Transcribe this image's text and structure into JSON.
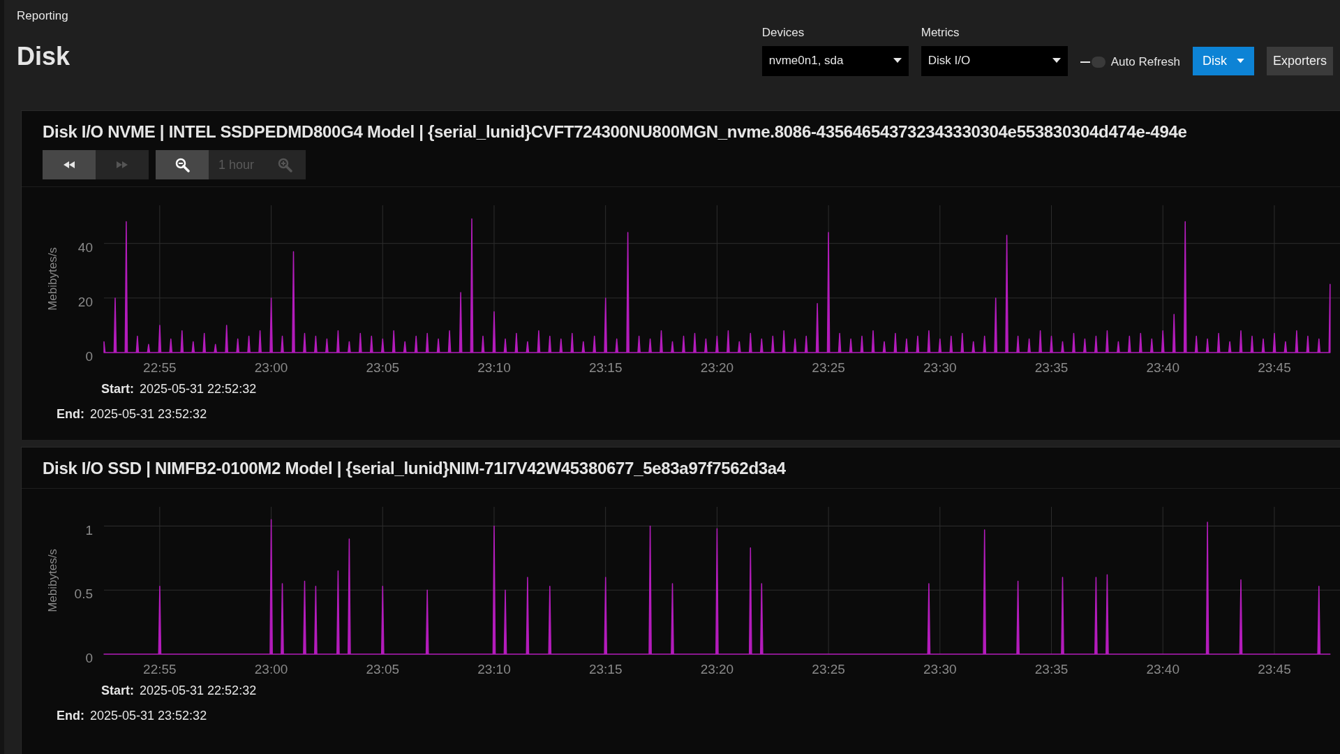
{
  "breadcrumb": "Reporting",
  "page_title": "Disk",
  "filters": [
    {
      "label": "Devices",
      "value": "nvme0n1, sda"
    },
    {
      "label": "Metrics",
      "value": "Disk I/O"
    }
  ],
  "auto_refresh": {
    "label": "Auto Refresh",
    "on": false
  },
  "buttons": [
    {
      "kind": "primary",
      "label": "Disk",
      "caret": true
    },
    {
      "kind": "secondary",
      "label": "Exporters",
      "caret": false
    }
  ],
  "charts": [
    {
      "title": "Disk I/O NVME | INTEL SSDPEDMD800G4 Model | {serial_lunid}CVFT724300NU800MGN_nvme.8086-435646543732343330304e553830304d474e-494e",
      "toolbar": {
        "nav": [
          {
            "kind": "rewind",
            "disabled": false
          },
          {
            "kind": "forward",
            "disabled": true
          }
        ],
        "zoom_out": {
          "disabled": false
        },
        "range": "1 hour",
        "zoom_in": {
          "disabled": true
        }
      },
      "chart_data": {
        "type": "area",
        "ylabel": "Mebibytes/s",
        "grid": true,
        "ylim": [
          0,
          54
        ],
        "yticks": [
          0,
          20,
          40
        ],
        "categories": [
          null,
          null,
          null,
          null,
          null,
          "22:55",
          null,
          null,
          null,
          null,
          null,
          null,
          null,
          null,
          null,
          "23:00",
          null,
          null,
          null,
          null,
          null,
          null,
          null,
          null,
          null,
          "23:05",
          null,
          null,
          null,
          null,
          null,
          null,
          null,
          null,
          null,
          "23:10",
          null,
          null,
          null,
          null,
          null,
          null,
          null,
          null,
          null,
          "23:15",
          null,
          null,
          null,
          null,
          null,
          null,
          null,
          null,
          null,
          "23:20",
          null,
          null,
          null,
          null,
          null,
          null,
          null,
          null,
          null,
          "23:25",
          null,
          null,
          null,
          null,
          null,
          null,
          null,
          null,
          null,
          "23:30",
          null,
          null,
          null,
          null,
          null,
          null,
          null,
          null,
          null,
          "23:35",
          null,
          null,
          null,
          null,
          null,
          null,
          null,
          null,
          null,
          "23:40",
          null,
          null,
          null,
          null,
          null,
          null,
          null,
          null,
          null,
          "23:45",
          null,
          null,
          null,
          null,
          null
        ],
        "series": [
          {
            "color": "#b41cbc",
            "values": [
              4,
              20,
              48,
              6,
              3,
              10,
              5,
              8,
              4,
              7,
              3,
              10,
              5,
              6,
              8,
              20,
              6,
              37,
              7,
              6,
              5,
              8,
              4,
              7,
              6,
              5,
              8,
              4,
              6,
              7,
              5,
              8,
              22,
              49,
              6,
              15,
              5,
              7,
              4,
              8,
              6,
              5,
              7,
              4,
              6,
              20,
              5,
              44,
              6,
              5,
              8,
              4,
              6,
              7,
              5,
              6,
              8,
              4,
              7,
              5,
              6,
              8,
              5,
              6,
              18,
              44,
              7,
              5,
              6,
              8,
              4,
              7,
              5,
              6,
              8,
              5,
              6,
              7,
              4,
              6,
              20,
              43,
              6,
              5,
              8,
              6,
              4,
              7,
              5,
              6,
              8,
              4,
              6,
              7,
              5,
              8,
              14,
              48,
              6,
              5,
              7,
              4,
              8,
              6,
              5,
              7,
              4,
              8,
              6,
              5,
              25
            ]
          }
        ]
      },
      "start_label": "Start:",
      "start": "2025-05-31 22:52:32",
      "end_label": "End:",
      "end": "2025-05-31 23:52:32"
    },
    {
      "title": "Disk I/O SSD | NIMFB2-0100M2 Model | {serial_lunid}NIM-71I7V42W45380677_5e83a97f7562d3a4",
      "chart_data": {
        "type": "area",
        "ylabel": "Mebibytes/s",
        "grid": true,
        "ylim": [
          0,
          1.15
        ],
        "yticks": [
          0,
          0.5,
          1
        ],
        "categories": [
          null,
          null,
          null,
          null,
          null,
          "22:55",
          null,
          null,
          null,
          null,
          null,
          null,
          null,
          null,
          null,
          "23:00",
          null,
          null,
          null,
          null,
          null,
          null,
          null,
          null,
          null,
          "23:05",
          null,
          null,
          null,
          null,
          null,
          null,
          null,
          null,
          null,
          "23:10",
          null,
          null,
          null,
          null,
          null,
          null,
          null,
          null,
          null,
          "23:15",
          null,
          null,
          null,
          null,
          null,
          null,
          null,
          null,
          null,
          "23:20",
          null,
          null,
          null,
          null,
          null,
          null,
          null,
          null,
          null,
          "23:25",
          null,
          null,
          null,
          null,
          null,
          null,
          null,
          null,
          null,
          "23:30",
          null,
          null,
          null,
          null,
          null,
          null,
          null,
          null,
          null,
          "23:35",
          null,
          null,
          null,
          null,
          null,
          null,
          null,
          null,
          null,
          "23:40",
          null,
          null,
          null,
          null,
          null,
          null,
          null,
          null,
          null,
          "23:45",
          null,
          null,
          null,
          null,
          null
        ],
        "series": [
          {
            "color": "#b41cbc",
            "values": [
              0,
              0,
              0,
              0,
              0,
              0.53,
              0,
              0,
              0,
              0,
              0,
              0,
              0,
              0,
              0,
              1.05,
              0.55,
              0,
              0.57,
              0.53,
              0,
              0.65,
              0.9,
              0,
              0,
              0.53,
              0,
              0,
              0,
              0.5,
              0,
              0,
              0,
              0,
              0,
              1.0,
              0.5,
              0,
              0.6,
              0,
              0.53,
              0,
              0,
              0,
              0,
              0.6,
              0,
              0,
              0,
              1.0,
              0,
              0.55,
              0,
              0,
              0,
              0.98,
              0,
              0,
              0.83,
              0.55,
              0,
              0,
              0,
              0,
              0,
              0,
              0,
              0,
              0,
              0,
              0,
              0,
              0,
              0,
              0.55,
              0,
              0,
              0,
              0,
              0.97,
              0,
              0,
              0.57,
              0,
              0,
              0,
              0.6,
              0,
              0,
              0.6,
              0.62,
              0,
              0,
              0,
              0,
              0,
              0,
              0,
              0,
              1.03,
              0,
              0,
              0.58,
              0,
              0,
              0,
              0,
              0,
              0,
              0.53,
              0
            ]
          }
        ]
      },
      "start_label": "Start:",
      "start": "2025-05-31 22:52:32",
      "end_label": "End:",
      "end": "2025-05-31 23:52:32"
    }
  ]
}
